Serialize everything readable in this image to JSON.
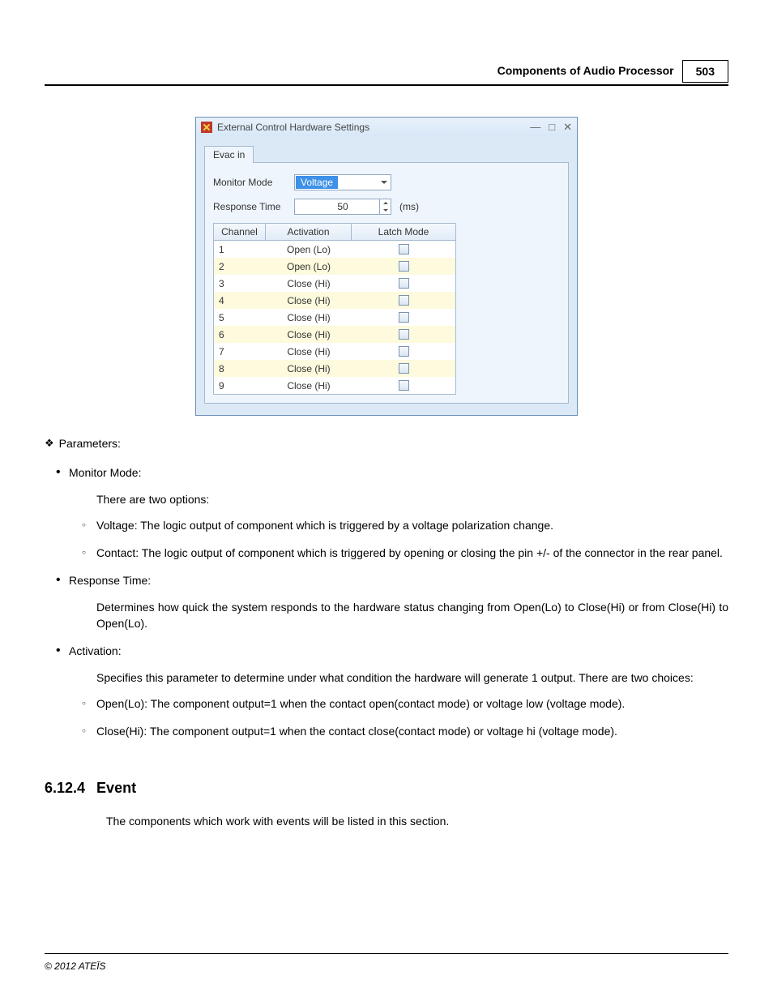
{
  "header": {
    "title": "Components of Audio Processor",
    "page": "503"
  },
  "win": {
    "title": "External Control Hardware Settings",
    "tab": "Evac in",
    "monitor_mode_label": "Monitor Mode",
    "monitor_mode_value": "Voltage",
    "response_time_label": "Response Time",
    "response_time_value": "50",
    "response_time_unit": "(ms)",
    "grid": {
      "col_channel": "Channel",
      "col_activation": "Activation",
      "col_latch": "Latch Mode",
      "rows": [
        {
          "ch": "1",
          "ac": "Open (Lo)"
        },
        {
          "ch": "2",
          "ac": "Open (Lo)"
        },
        {
          "ch": "3",
          "ac": "Close (Hi)"
        },
        {
          "ch": "4",
          "ac": "Close (Hi)"
        },
        {
          "ch": "5",
          "ac": "Close (Hi)"
        },
        {
          "ch": "6",
          "ac": "Close (Hi)"
        },
        {
          "ch": "7",
          "ac": "Close (Hi)"
        },
        {
          "ch": "8",
          "ac": "Close (Hi)"
        },
        {
          "ch": "9",
          "ac": "Close (Hi)"
        }
      ]
    }
  },
  "text": {
    "params": "Parameters:",
    "mm_head": "Monitor Mode:",
    "mm_line": "There are two options:",
    "mm_opt1": "Voltage: The logic output of component which is triggered by a voltage polarization change.",
    "mm_opt2": "Contact: The logic output of component which is triggered by opening or closing the pin +/- of the connector in the rear panel.",
    "rt_head": "Response Time:",
    "rt_body": "Determines how quick the system responds to the hardware status changing from Open(Lo) to Close(Hi) or from Close(Hi) to Open(Lo).",
    "ac_head": "Activation:",
    "ac_body": "Specifies this parameter to determine under what condition the hardware will generate 1 output. There are two choices:",
    "ac_opt1": "Open(Lo): The component output=1 when the contact open(contact mode) or voltage low (voltage mode).",
    "ac_opt2": "Close(Hi): The component output=1 when the contact close(contact mode) or voltage hi (voltage mode)."
  },
  "section": {
    "num": "6.12.4",
    "title": "Event",
    "body": "The components which work with events will be listed in this section."
  },
  "footer": "© 2012 ATEÏS"
}
